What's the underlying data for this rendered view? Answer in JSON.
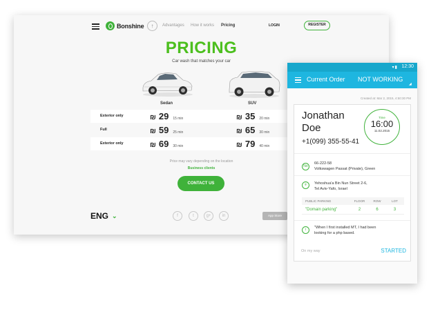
{
  "site": {
    "logo": "Bonshine",
    "nav": {
      "advantages": "Advantages",
      "how": "How it works",
      "pricing": "Pricing",
      "login": "LOGIN",
      "register": "REGISTER"
    },
    "title": "PRICING",
    "subtitle": "Car wash that matches your car",
    "cars": [
      "Sedan",
      "SUV"
    ],
    "currency": "₪",
    "rows": [
      {
        "label": "Exterior only",
        "sedan": "29",
        "sedan_time": "15 min",
        "suv": "35",
        "suv_time": "20 min"
      },
      {
        "label": "Full",
        "sedan": "59",
        "sedan_time": "25 min",
        "suv": "65",
        "suv_time": "30 min"
      },
      {
        "label": "Exterior only",
        "sedan": "69",
        "sedan_time": "30 min",
        "suv": "79",
        "suv_time": "40 min"
      }
    ],
    "note": "Price may vary depending on the location",
    "business": "Business clients",
    "contact": "CONTACT US",
    "lang": "ENG",
    "social": [
      "f",
      "t",
      "g+",
      "in"
    ],
    "store": "App Store"
  },
  "phone": {
    "time": "12:30",
    "app_title": "Current Order",
    "app_status": "NOT WORKING",
    "created": "Created at: Mar 2, 2015, 4:50:30 PM",
    "customer_first": "Jonathan",
    "customer_last": "Doe",
    "customer_phone": "+1(099) 355-55-41",
    "timer_label": "Time",
    "timer_value": "16:00",
    "timer_date": "11.02.2015",
    "plate": "66-222-58",
    "vehicle": "Volkswagen Passat (Private), Green",
    "address1": "Yehoshua'a Bin Nun Street 2-6,",
    "address2": "Tel Aviv-Yafo, Israel",
    "parking_head": [
      "PUBLIC PARKING",
      "FLOOR",
      "ROW",
      "LOT"
    ],
    "parking_row": [
      "\"Domain parking\"",
      "2",
      "6",
      "3"
    ],
    "comment1": "\"When I first installed MT, I had been",
    "comment2": "looking for a php based.",
    "on_way": "On my way",
    "started": "STARTED"
  }
}
